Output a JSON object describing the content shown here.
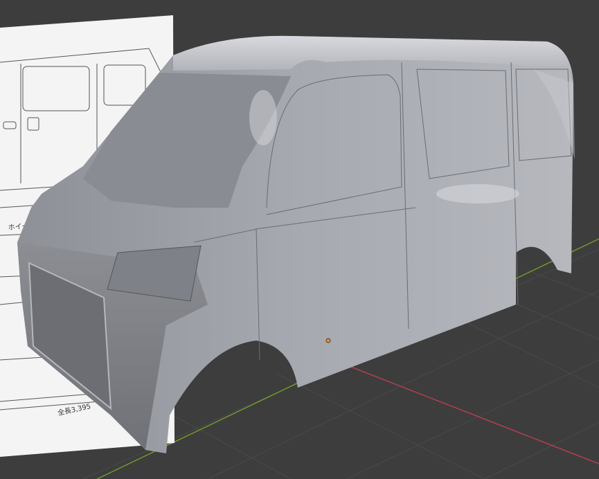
{
  "viewport": {
    "background_color": "#3d3d3d",
    "grid_color": "#4a4a4a",
    "x_axis_color": "#b5404a",
    "y_axis_color": "#6f9a2a",
    "model_color": "#a3a5ab",
    "origin_marker_color": "#e8902a"
  },
  "reference_image": {
    "labels": [
      "ホイー",
      "全長3,395"
    ]
  }
}
